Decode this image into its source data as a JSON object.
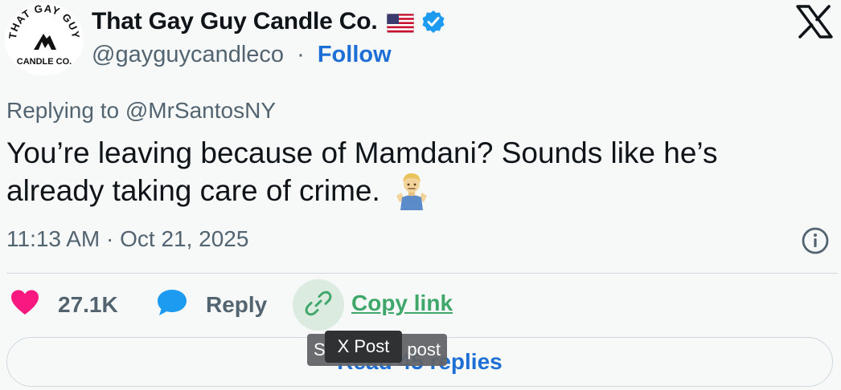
{
  "author": {
    "display_name": "That Gay Guy Candle Co.",
    "handle": "@gayguycandleco",
    "separator": "·",
    "follow_label": "Follow",
    "avatar_text_top": "THAT GAY GUY",
    "avatar_text_bottom": "CANDLE CO.",
    "flag_icon": "us-flag-icon",
    "verified_icon": "verified-badge-icon"
  },
  "platform": {
    "logo_icon": "x-logo-icon"
  },
  "tweet": {
    "replying_to": "Replying to @MrSantosNY",
    "text": "You’re leaving because of Mamdani? Sounds like he’s already taking care of crime.",
    "emoji_icon": "person-shrugging-icon",
    "timestamp": "11:13 AM · Oct 21, 2025"
  },
  "actions": {
    "likes": "27.1K",
    "reply_label": "Reply",
    "copy_link_label": "Copy link",
    "read_replies_label": "Read 45 replies"
  },
  "tooltips": {
    "back_left": "S",
    "back_right": "post",
    "front": "X Post"
  },
  "colors": {
    "background": "#f7f9f9",
    "link_blue": "#1d6fd6",
    "like_pink": "#f91880",
    "reply_blue": "#1d9bf0",
    "copy_green": "#3fa76a",
    "muted": "#536471"
  }
}
